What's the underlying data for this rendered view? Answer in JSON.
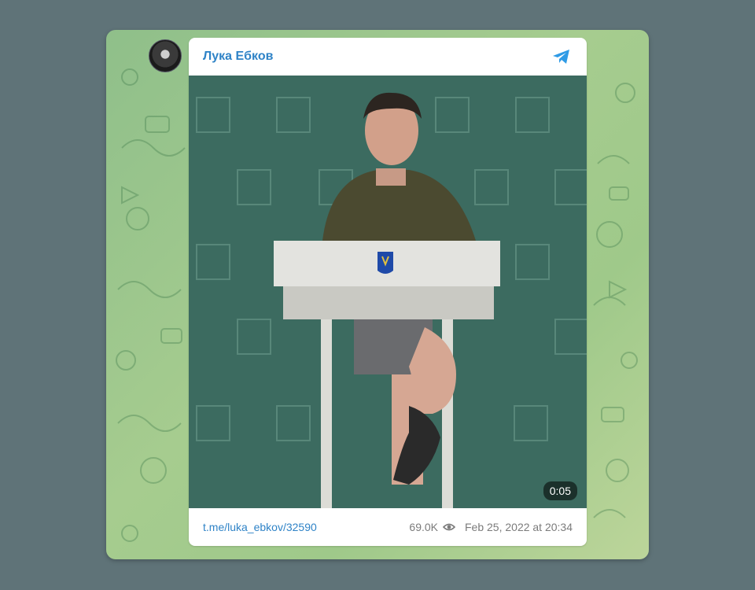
{
  "channel": {
    "name": "Лука Ебков",
    "avatar_icon": "avatar-photo-icon",
    "share_icon": "telegram-plane-icon"
  },
  "video": {
    "duration": "0:05"
  },
  "footer": {
    "link": "t.me/luka_ebkov/32590",
    "views": "69.0K",
    "views_icon": "eye-icon",
    "date": "Feb 25, 2022 at 20:34"
  },
  "colors": {
    "accent": "#2f83c7",
    "background": "#5f7378"
  }
}
